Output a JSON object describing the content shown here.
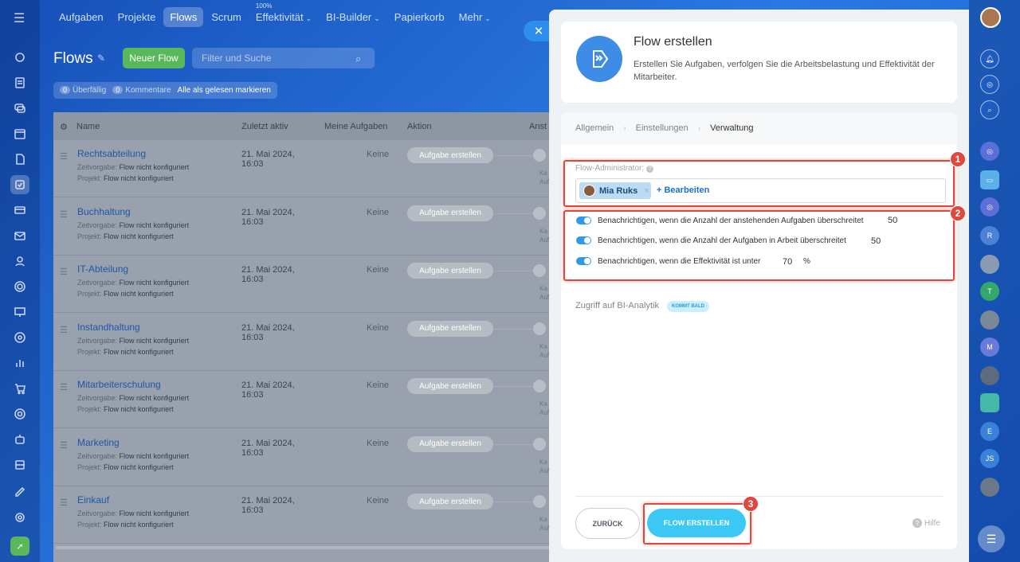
{
  "nav": {
    "items": [
      {
        "label": "Aufgaben"
      },
      {
        "label": "Projekte"
      },
      {
        "label": "Flows",
        "active": true
      },
      {
        "label": "Scrum"
      },
      {
        "label": "Effektivität",
        "super": "100%",
        "caret": true
      },
      {
        "label": "BI-Builder",
        "caret": true
      },
      {
        "label": "Papierkorb"
      },
      {
        "label": "Mehr",
        "caret": true
      }
    ]
  },
  "page": {
    "title": "Flows",
    "new_button": "Neuer Flow",
    "search_placeholder": "Filter und Suche",
    "counters": {
      "overdue_count": "0",
      "overdue_label": "Überfällig",
      "comments_count": "0",
      "comments_label": "Kommentare",
      "mark_read": "Alle als gelesen markieren"
    }
  },
  "table": {
    "headers": {
      "name": "Name",
      "last_active": "Zuletzt aktiv",
      "my_tasks": "Meine Aufgaben",
      "action": "Aktion",
      "extra": "Anst"
    },
    "sub_labels": {
      "deadline": "Zeitvorgabe:",
      "project": "Projekt:"
    },
    "rows": [
      {
        "name": "Rechtsabteilung",
        "deadline": "Flow nicht konfiguriert",
        "project": "Flow nicht konfiguriert",
        "date": "21. Mai 2024, 16:03",
        "tasks": "Keine",
        "action": "Aufgabe erstellen",
        "k": "Ka\nAuf"
      },
      {
        "name": "Buchhaltung",
        "deadline": "Flow nicht konfiguriert",
        "project": "Flow nicht konfiguriert",
        "date": "21. Mai 2024, 16:03",
        "tasks": "Keine",
        "action": "Aufgabe erstellen",
        "k": "Ka\nAuf"
      },
      {
        "name": "IT-Abteilung",
        "deadline": "Flow nicht konfiguriert",
        "project": "Flow nicht konfiguriert",
        "date": "21. Mai 2024, 16:03",
        "tasks": "Keine",
        "action": "Aufgabe erstellen",
        "k": "Ka\nAuf"
      },
      {
        "name": "Instandhaltung",
        "deadline": "Flow nicht konfiguriert",
        "project": "Flow nicht konfiguriert",
        "date": "21. Mai 2024, 16:03",
        "tasks": "Keine",
        "action": "Aufgabe erstellen",
        "k": "Ka\nAuf"
      },
      {
        "name": "Mitarbeiterschulung",
        "deadline": "Flow nicht konfiguriert",
        "project": "Flow nicht konfiguriert",
        "date": "21. Mai 2024, 16:03",
        "tasks": "Keine",
        "action": "Aufgabe erstellen",
        "k": "Ka\nAuf"
      },
      {
        "name": "Marketing",
        "deadline": "Flow nicht konfiguriert",
        "project": "Flow nicht konfiguriert",
        "date": "21. Mai 2024, 16:03",
        "tasks": "Keine",
        "action": "Aufgabe erstellen",
        "k": "Ka\nAuf"
      },
      {
        "name": "Einkauf",
        "deadline": "Flow nicht konfiguriert",
        "project": "Flow nicht konfiguriert",
        "date": "21. Mai 2024, 16:03",
        "tasks": "Keine",
        "action": "Aufgabe erstellen",
        "k": "Ka\nAuf"
      }
    ]
  },
  "panel": {
    "title": "Flow erstellen",
    "description": "Erstellen Sie Aufgaben, verfolgen Sie die Arbeitsbelastung und Effektivität der Mitarbeiter.",
    "tabs": [
      "Allgemein",
      "Einstellungen",
      "Verwaltung"
    ],
    "admin_label": "Flow-Administrator:",
    "admin_user": "Mia Ruks",
    "edit_link": "+ Bearbeiten",
    "toggles": [
      {
        "label": "Benachrichtigen, wenn die Anzahl der anstehenden Aufgaben überschreitet",
        "value": "50",
        "unit": "",
        "on": true
      },
      {
        "label": "Benachrichtigen, wenn die Anzahl der Aufgaben in Arbeit überschreitet",
        "value": "50",
        "unit": "",
        "on": true
      },
      {
        "label": "Benachrichtigen, wenn die Effektivität ist unter",
        "value": "70",
        "unit": "%",
        "on": true
      }
    ],
    "bi_label": "Zugriff auf BI-Analytik",
    "bi_badge": "KOMMT BALD",
    "back_button": "ZURÜCK",
    "create_button": "FLOW ERSTELLEN",
    "help": "Hilfe"
  },
  "annotations": [
    "1",
    "2",
    "3"
  ],
  "right_bar": {
    "letters": [
      "R",
      "T",
      "M",
      "E",
      "JS"
    ]
  },
  "colors": {
    "accent": "#3bc8f5",
    "highlight": "#e2473d",
    "green": "#58b85a",
    "toggle": "#2f9be8"
  }
}
